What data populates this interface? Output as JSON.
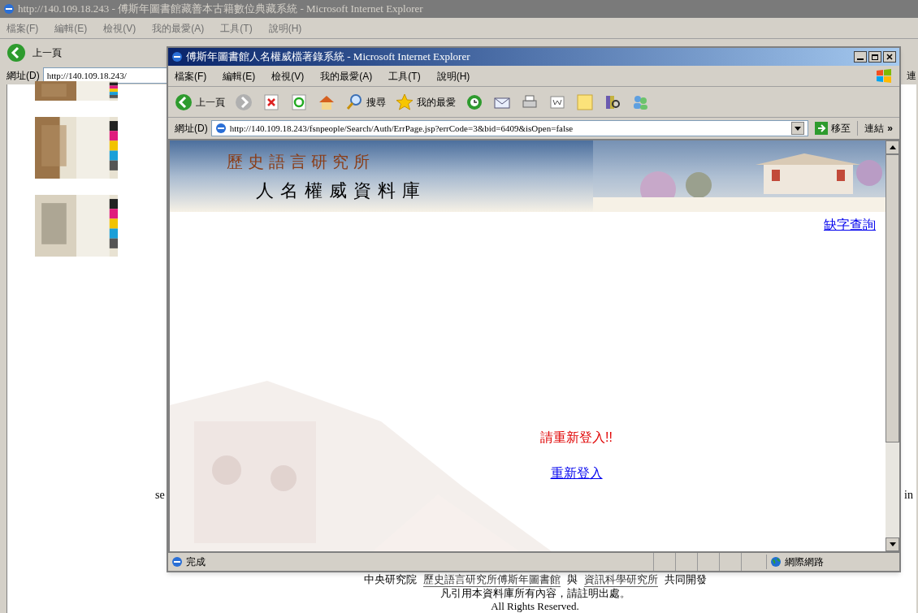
{
  "back_window": {
    "title": "http://140.109.18.243 - 傅斯年圖書館藏善本古籍數位典藏系統 - Microsoft Internet Explorer",
    "active": false,
    "menu": [
      "檔案(F)",
      "編輯(E)",
      "檢視(V)",
      "我的最愛(A)",
      "工具(T)",
      "說明(H)"
    ],
    "back_label": "上一頁",
    "address_label": "網址(D)",
    "address": "http://140.109.18.243/",
    "links_label": "連",
    "page": {
      "text_left": "se",
      "text_right": "in",
      "footer": {
        "parts": [
          {
            "text": "中央研究院",
            "link": false
          },
          {
            "text": "歷史語言研究所傅斯年圖書館",
            "link": true
          },
          {
            "text": "與",
            "link": false
          },
          {
            "text": "資訊科學研究所",
            "link": true
          },
          {
            "text": "共同開發",
            "link": false
          }
        ],
        "notice": "凡引用本資料庫所有內容，請註明出處。",
        "rights": "All Rights Reserved."
      }
    }
  },
  "front_window": {
    "title": "傅斯年圖書館人名權威檔著錄系統 - Microsoft Internet Explorer",
    "active": true,
    "menu": [
      "檔案(F)",
      "編輯(E)",
      "檢視(V)",
      "我的最愛(A)",
      "工具(T)",
      "說明(H)"
    ],
    "toolbar": {
      "back_label": "上一頁",
      "search_label": "搜尋",
      "favorites_label": "我的最愛"
    },
    "address_label": "網址(D)",
    "address": "http://140.109.18.243/fsnpeople/Search/Auth/ErrPage.jsp?errCode=3&bid=6409&isOpen=false",
    "go_label": "移至",
    "links_label": "連結",
    "links_more": "»",
    "page": {
      "banner_title": "歷史語言研究所",
      "banner_subtitle": "人名權威資料庫",
      "missing_char_link": "缺字查詢",
      "message": "請重新登入!!",
      "login_link": "重新登入"
    },
    "status": "完成",
    "zone": "網際網路"
  }
}
